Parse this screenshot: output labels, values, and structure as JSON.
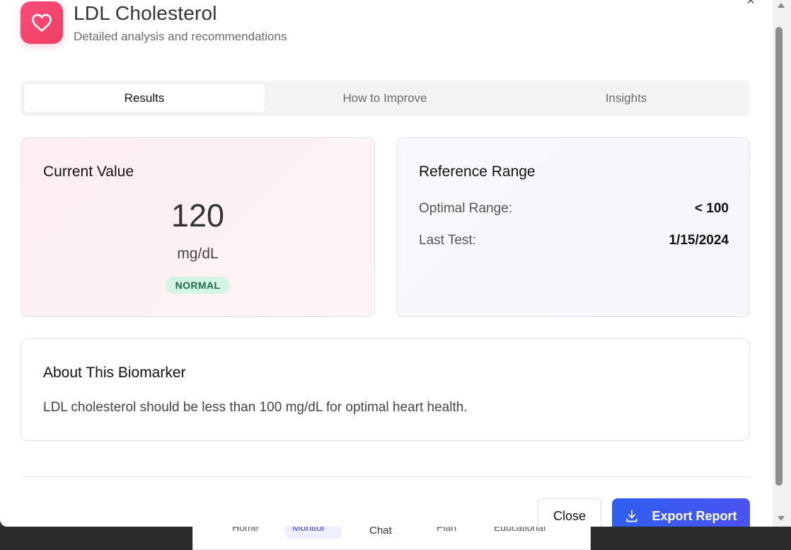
{
  "header": {
    "title": "LDL Cholesterol",
    "subtitle": "Detailed analysis and recommendations",
    "icon": "heart-icon",
    "accent_color": "#f0466d"
  },
  "tabs": [
    {
      "label": "Results",
      "active": true
    },
    {
      "label": "How to Improve",
      "active": false
    },
    {
      "label": "Insights",
      "active": false
    }
  ],
  "current_value": {
    "title": "Current Value",
    "value": "120",
    "unit": "mg/dL",
    "status": "NORMAL",
    "status_color": "#1f6b45"
  },
  "reference_range": {
    "title": "Reference Range",
    "optimal_label": "Optimal Range:",
    "optimal_value": "< 100",
    "last_test_label": "Last Test:",
    "last_test_value": "1/15/2024"
  },
  "about": {
    "title": "About This Biomarker",
    "text": "LDL cholesterol should be less than 100 mg/dL for optimal heart health."
  },
  "actions": {
    "close_label": "Close",
    "export_label": "Export Report",
    "export_color": "#3a5bf0"
  },
  "background_nav": {
    "items": [
      "Home",
      "Monitor",
      "Chat",
      "Plan",
      "Educational"
    ]
  }
}
